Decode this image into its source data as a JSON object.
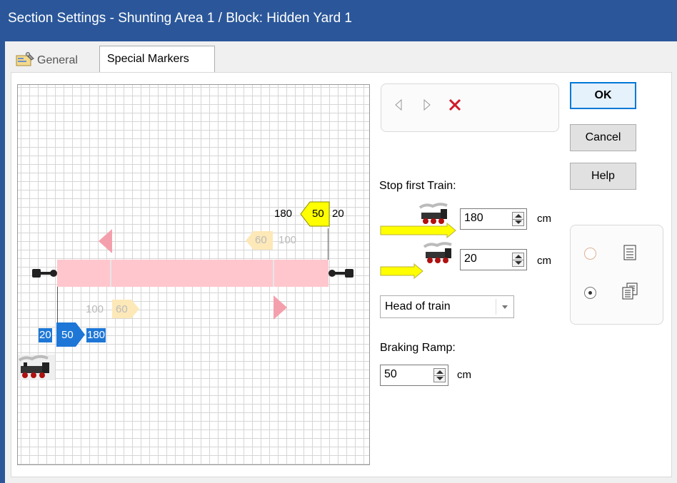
{
  "window": {
    "title": "Section Settings - Shunting Area 1 / Block: Hidden Yard 1"
  },
  "tabs": [
    {
      "label": "General",
      "icon": "properties-icon"
    },
    {
      "label": "Special Markers"
    }
  ],
  "diagram": {
    "top_marker_left": "180",
    "top_marker_box": "50",
    "top_marker_right": "20",
    "top_gray_left": "60",
    "top_gray_right": "100",
    "bottom_gray_left": "100",
    "bottom_gray_right": "60",
    "bottom_marker_left": "20",
    "bottom_marker_box": "50",
    "bottom_marker_right": "180",
    "colors": {
      "track": "#ffc7cd",
      "yellow_marker": "#ffff00",
      "blue_marker": "#1e77d6",
      "pink_marker": "#f4a0ac",
      "gray_marker": "#fde8b8"
    }
  },
  "navigation": {
    "prev_icon": "triangle-left-icon",
    "next_icon": "triangle-right-icon",
    "delete_icon": "red-x-icon"
  },
  "buttons": {
    "ok": "OK",
    "cancel": "Cancel",
    "help": "Help"
  },
  "stop_first_train": {
    "label": "Stop first Train:",
    "distance1": "180",
    "unit1": "cm",
    "distance2": "20",
    "unit2": "cm"
  },
  "reference": {
    "selected": "Head of train"
  },
  "braking_ramp": {
    "label": "Braking Ramp:",
    "value": "50",
    "unit": "cm"
  },
  "mode": {
    "option1_icon": "list-icon",
    "option2_icon": "copy-icon",
    "selected": 2
  }
}
